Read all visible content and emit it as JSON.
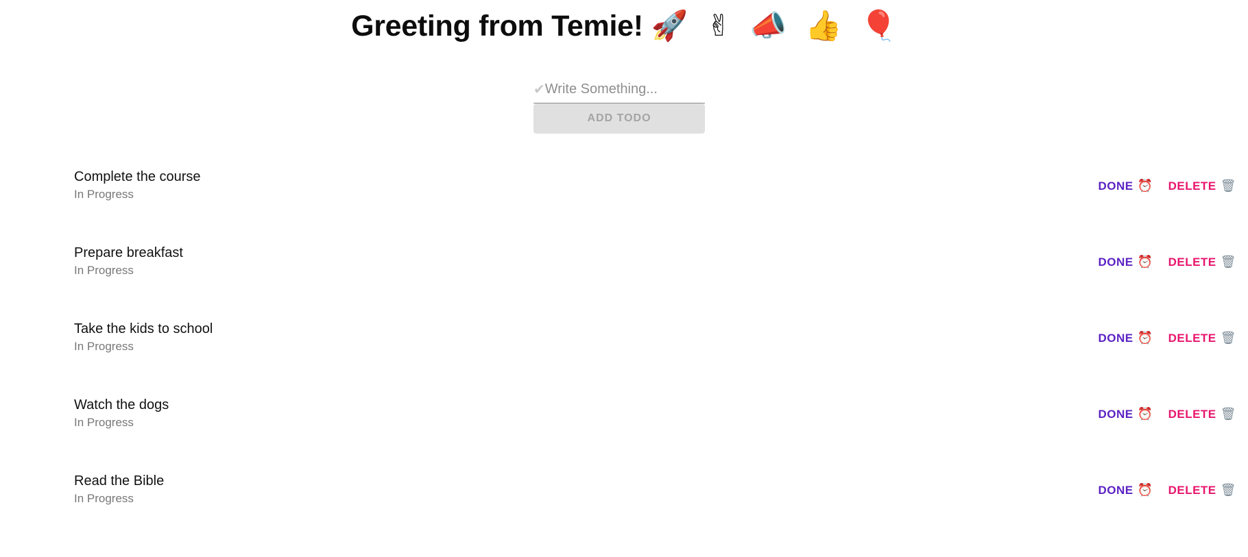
{
  "header": {
    "title": "Greeting from Temie!",
    "emojis": "🚀 ✌ 📣 👍 🎈"
  },
  "form": {
    "check_icon": "✔",
    "placeholder": "Write Something...",
    "value": "",
    "add_label": "ADD TODO"
  },
  "todos": [
    {
      "title": "Complete the course",
      "status": "In Progress",
      "done_label": "DONE",
      "done_icon": "⏰",
      "delete_label": "DELETE",
      "delete_icon": "🗑"
    },
    {
      "title": "Prepare breakfast",
      "status": "In Progress",
      "done_label": "DONE",
      "done_icon": "⏰",
      "delete_label": "DELETE",
      "delete_icon": "🗑"
    },
    {
      "title": "Take the kids to school",
      "status": "In Progress",
      "done_label": "DONE",
      "done_icon": "⏰",
      "delete_label": "DELETE",
      "delete_icon": "🗑"
    },
    {
      "title": "Watch the dogs",
      "status": "In Progress",
      "done_label": "DONE",
      "done_icon": "⏰",
      "delete_label": "DELETE",
      "delete_icon": "🗑"
    },
    {
      "title": "Read the Bible",
      "status": "In Progress",
      "done_label": "DONE",
      "done_icon": "⏰",
      "delete_label": "DELETE",
      "delete_icon": "🗑"
    }
  ],
  "colors": {
    "done": "#5b21c4",
    "delete": "#e8146c",
    "button_bg": "#e0e0e0"
  }
}
